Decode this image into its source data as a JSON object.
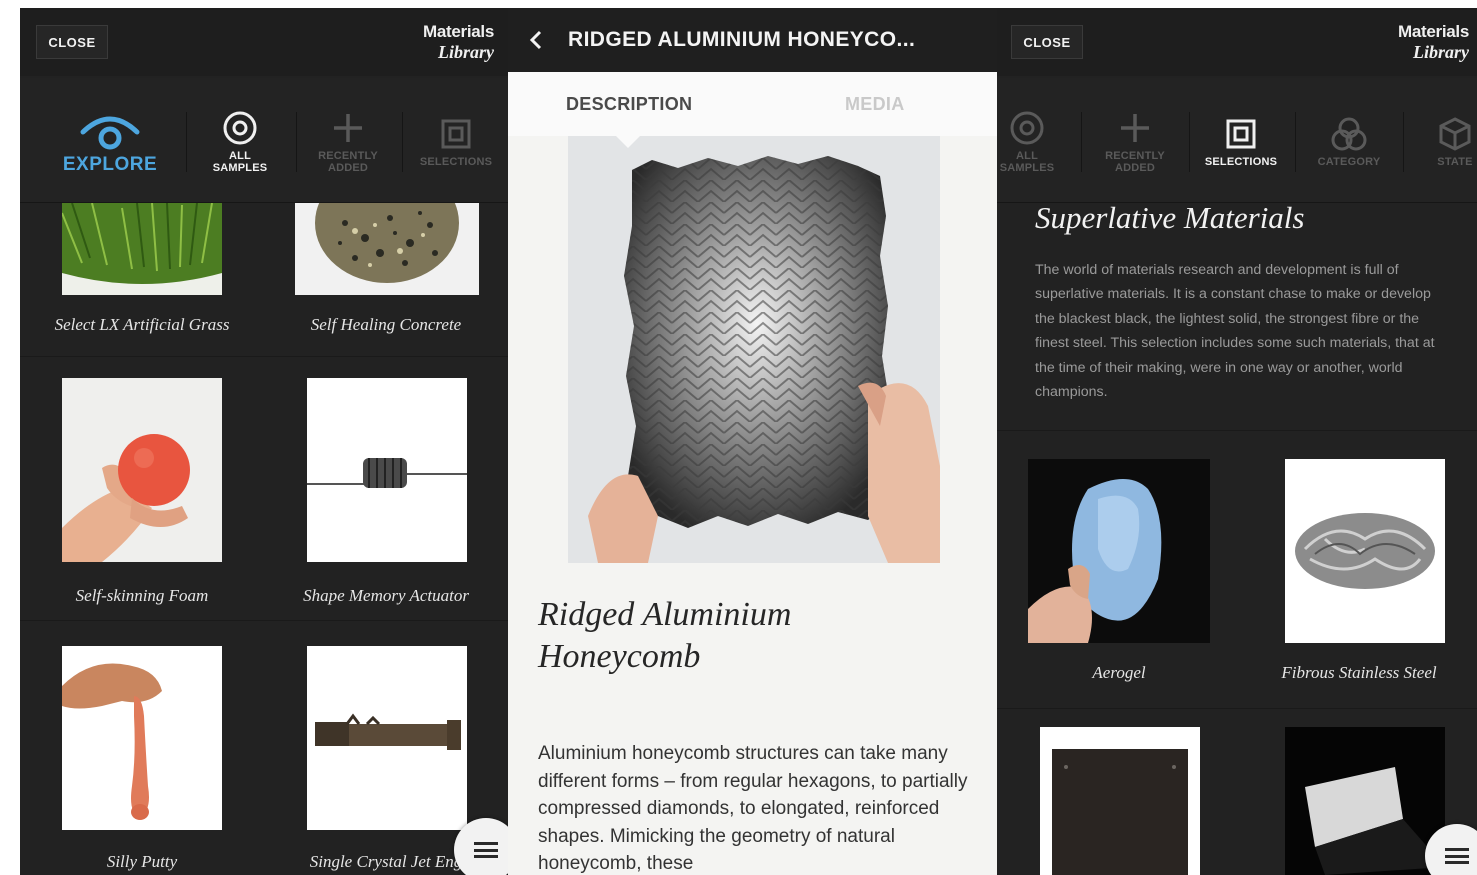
{
  "left": {
    "close_label": "CLOSE",
    "logo": {
      "line1": "Materials",
      "line2": "Library"
    },
    "nav": [
      {
        "label": "EXPLORE",
        "icon": "eye-icon"
      },
      {
        "label": "ALL\nSAMPLES",
        "icon": "target-icon"
      },
      {
        "label": "RECENTLY\nADDED",
        "icon": "plus-icon"
      },
      {
        "label": "SELECTIONS",
        "icon": "square-icon"
      }
    ],
    "samples": [
      {
        "caption": "Select LX Artificial Grass"
      },
      {
        "caption": "Self Healing Concrete"
      },
      {
        "caption": "Self-skinning Foam"
      },
      {
        "caption": "Shape Memory Actuator"
      },
      {
        "caption": "Silly Putty"
      },
      {
        "caption": "Single Crystal Jet Eng"
      }
    ]
  },
  "middle": {
    "header_title": "RIDGED ALUMINIUM HONEYCO...",
    "tabs": {
      "description": "DESCRIPTION",
      "media": "MEDIA"
    },
    "product_title": "Ridged Aluminium\nHoneycomb",
    "description": "Aluminium honeycomb structures can take many different forms – from regular hexagons, to partially compressed diamonds, to elongated, reinforced shapes. Mimicking the geometry of natural honeycomb, these"
  },
  "right": {
    "close_label": "CLOSE",
    "logo": {
      "line1": "Materials",
      "line2": "Library"
    },
    "nav": [
      {
        "label": "ALL\nSAMPLES",
        "icon": "target-icon"
      },
      {
        "label": "RECENTLY\nADDED",
        "icon": "plus-icon"
      },
      {
        "label": "SELECTIONS",
        "icon": "square-icon"
      },
      {
        "label": "CATEGORY",
        "icon": "circles-icon"
      },
      {
        "label": "STATE",
        "icon": "cube-icon"
      }
    ],
    "selection_title": "Superlative Materials",
    "selection_description": "The world of materials research and development is full of superlative materials. It is a constant chase to make or develop the blackest black, the lightest solid, the strongest fibre or the finest steel. This selection includes some such materials, that at the time of their making, were in one way or another, world champions.",
    "samples": [
      {
        "caption": "Aerogel"
      },
      {
        "caption": "Fibrous Stainless Steel"
      }
    ]
  },
  "colors": {
    "accent": "#4da6df",
    "dark_bg": "#222222",
    "light_bg": "#f4f4f2"
  }
}
